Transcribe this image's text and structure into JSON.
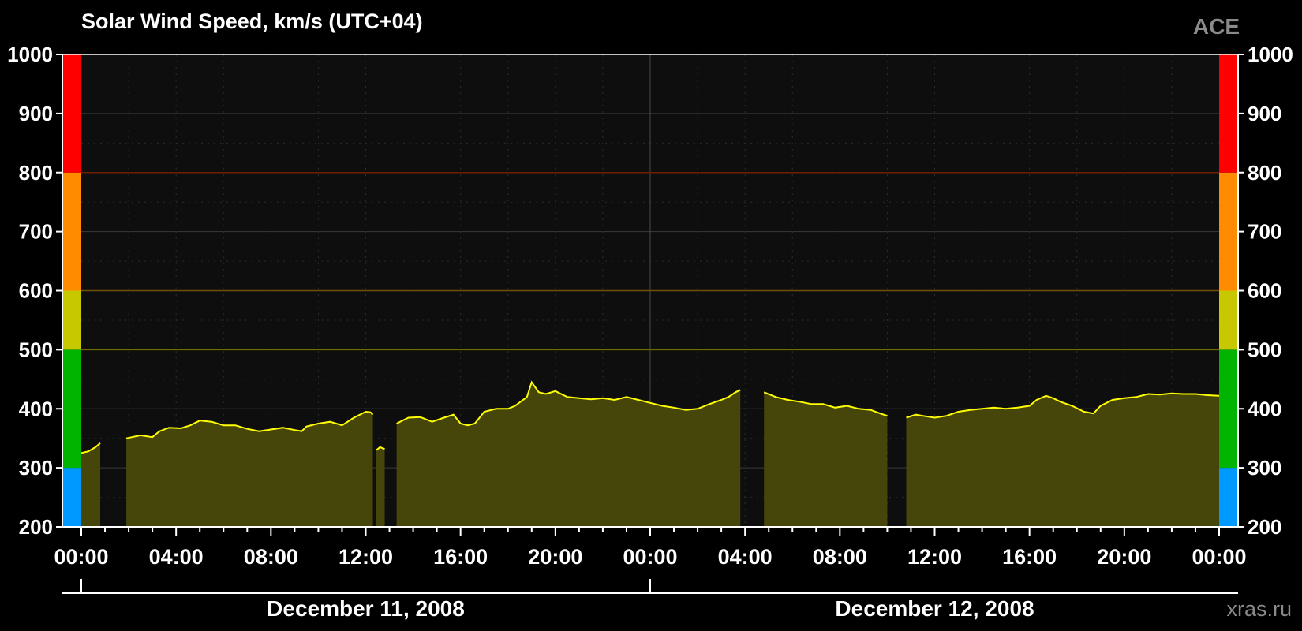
{
  "title": "Solar Wind Speed, km/s (UTC+04)",
  "source_label": "ACE",
  "credit": "xras.ru",
  "chart_data": {
    "type": "area",
    "title": "Solar Wind Speed, km/s (UTC+04)",
    "ylim": [
      200,
      1000
    ],
    "yticks": [
      200,
      300,
      400,
      500,
      600,
      700,
      800,
      900,
      1000
    ],
    "x_unit": "hours from December 11, 2008 00:00",
    "xlim": [
      0,
      48
    ],
    "xticks": [
      {
        "x": 0,
        "label": "00:00"
      },
      {
        "x": 4,
        "label": "04:00"
      },
      {
        "x": 8,
        "label": "08:00"
      },
      {
        "x": 12,
        "label": "12:00"
      },
      {
        "x": 16,
        "label": "16:00"
      },
      {
        "x": 20,
        "label": "20:00"
      },
      {
        "x": 24,
        "label": "00:00"
      },
      {
        "x": 28,
        "label": "04:00"
      },
      {
        "x": 32,
        "label": "08:00"
      },
      {
        "x": 36,
        "label": "12:00"
      },
      {
        "x": 40,
        "label": "16:00"
      },
      {
        "x": 44,
        "label": "20:00"
      },
      {
        "x": 48,
        "label": "00:00"
      }
    ],
    "date_labels": [
      {
        "label": "December 11, 2008",
        "from": 0,
        "to": 24
      },
      {
        "label": "December 12, 2008",
        "from": 24,
        "to": 48
      }
    ],
    "color_bands": [
      {
        "from": 200,
        "to": 300,
        "color": "#0099ff"
      },
      {
        "from": 300,
        "to": 500,
        "color": "#00b400"
      },
      {
        "from": 500,
        "to": 600,
        "color": "#c8c800"
      },
      {
        "from": 600,
        "to": 800,
        "color": "#ff8c00"
      },
      {
        "from": 800,
        "to": 1000,
        "color": "#ff0000"
      }
    ],
    "threshold_lines": [
      {
        "y": 500,
        "color": "#6e6e00"
      },
      {
        "y": 600,
        "color": "#6e5000"
      },
      {
        "y": 800,
        "color": "#6e1e00"
      }
    ],
    "series": [
      {
        "line_color": "#ffff00",
        "fill_color": "#46460a",
        "segments": [
          [
            [
              0.0,
              325
            ],
            [
              0.3,
              328
            ],
            [
              0.6,
              335
            ],
            [
              0.8,
              342
            ]
          ],
          [
            [
              1.9,
              350
            ],
            [
              2.5,
              355
            ],
            [
              3.0,
              352
            ],
            [
              3.3,
              362
            ],
            [
              3.7,
              368
            ],
            [
              4.2,
              367
            ],
            [
              4.6,
              372
            ],
            [
              5.0,
              380
            ],
            [
              5.5,
              378
            ],
            [
              6.0,
              372
            ],
            [
              6.5,
              372
            ],
            [
              7.0,
              366
            ],
            [
              7.5,
              362
            ],
            [
              8.0,
              365
            ],
            [
              8.5,
              368
            ],
            [
              9.0,
              364
            ],
            [
              9.3,
              362
            ],
            [
              9.5,
              370
            ],
            [
              10.0,
              375
            ],
            [
              10.5,
              378
            ],
            [
              11.0,
              372
            ],
            [
              11.5,
              385
            ],
            [
              12.0,
              395
            ],
            [
              12.2,
              394
            ],
            [
              12.3,
              390
            ]
          ],
          [
            [
              12.45,
              330
            ],
            [
              12.6,
              335
            ],
            [
              12.8,
              332
            ]
          ],
          [
            [
              13.3,
              375
            ],
            [
              13.8,
              385
            ],
            [
              14.3,
              386
            ],
            [
              14.8,
              378
            ],
            [
              15.3,
              385
            ],
            [
              15.7,
              390
            ],
            [
              16.0,
              375
            ],
            [
              16.3,
              372
            ],
            [
              16.6,
              375
            ],
            [
              17.0,
              395
            ],
            [
              17.5,
              400
            ],
            [
              18.0,
              400
            ],
            [
              18.3,
              405
            ],
            [
              18.8,
              420
            ],
            [
              19.0,
              445
            ],
            [
              19.3,
              428
            ],
            [
              19.6,
              425
            ],
            [
              20.0,
              430
            ],
            [
              20.5,
              420
            ],
            [
              21.0,
              418
            ],
            [
              21.5,
              416
            ],
            [
              22.0,
              418
            ],
            [
              22.5,
              415
            ],
            [
              23.0,
              420
            ],
            [
              23.5,
              415
            ],
            [
              24.0,
              410
            ],
            [
              24.5,
              405
            ],
            [
              25.0,
              402
            ],
            [
              25.5,
              398
            ],
            [
              26.0,
              400
            ],
            [
              26.5,
              408
            ],
            [
              27.0,
              415
            ],
            [
              27.3,
              420
            ],
            [
              27.6,
              428
            ],
            [
              27.8,
              432
            ]
          ],
          [
            [
              28.8,
              428
            ],
            [
              29.3,
              420
            ],
            [
              29.8,
              415
            ],
            [
              30.3,
              412
            ],
            [
              30.8,
              408
            ],
            [
              31.3,
              408
            ],
            [
              31.8,
              402
            ],
            [
              32.3,
              405
            ],
            [
              32.8,
              400
            ],
            [
              33.3,
              398
            ],
            [
              33.7,
              392
            ],
            [
              34.0,
              388
            ]
          ],
          [
            [
              34.8,
              385
            ],
            [
              35.2,
              390
            ],
            [
              35.5,
              388
            ],
            [
              36.0,
              385
            ],
            [
              36.5,
              388
            ],
            [
              37.0,
              395
            ],
            [
              37.5,
              398
            ],
            [
              38.0,
              400
            ],
            [
              38.5,
              402
            ],
            [
              39.0,
              400
            ],
            [
              39.5,
              402
            ],
            [
              40.0,
              405
            ],
            [
              40.3,
              415
            ],
            [
              40.7,
              422
            ],
            [
              41.0,
              418
            ],
            [
              41.3,
              412
            ],
            [
              41.8,
              405
            ],
            [
              42.3,
              395
            ],
            [
              42.7,
              392
            ],
            [
              43.0,
              405
            ],
            [
              43.5,
              415
            ],
            [
              44.0,
              418
            ],
            [
              44.5,
              420
            ],
            [
              45.0,
              425
            ],
            [
              45.5,
              424
            ],
            [
              46.0,
              426
            ],
            [
              46.5,
              425
            ],
            [
              47.0,
              425
            ],
            [
              47.5,
              423
            ],
            [
              48.0,
              422
            ]
          ]
        ]
      }
    ]
  }
}
